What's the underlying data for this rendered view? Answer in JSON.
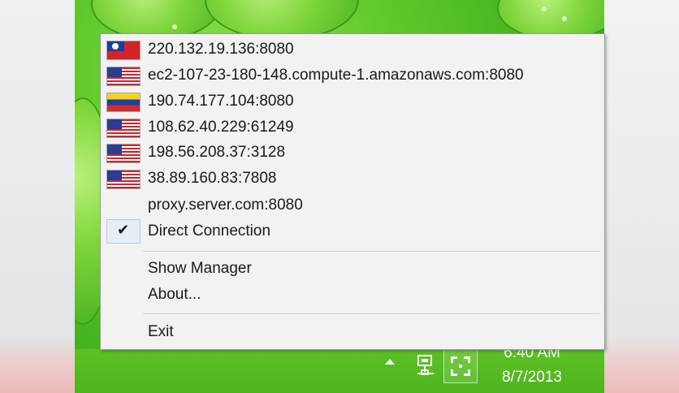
{
  "menu": {
    "proxies": [
      {
        "label": "220.132.19.136:8080",
        "flag": "taiwan-flag"
      },
      {
        "label": "ec2-107-23-180-148.compute-1.amazonaws.com:8080",
        "flag": "usa-flag"
      },
      {
        "label": "190.74.177.104:8080",
        "flag": "venezuela-flag"
      },
      {
        "label": "108.62.40.229:61249",
        "flag": "usa-flag"
      },
      {
        "label": "198.56.208.37:3128",
        "flag": "usa-flag"
      },
      {
        "label": "38.89.160.83:7808",
        "flag": "usa-flag"
      },
      {
        "label": "proxy.server.com:8080",
        "flag": ""
      }
    ],
    "direct_connection": {
      "label": "Direct Connection",
      "checked": true
    },
    "show_manager": "Show Manager",
    "about": "About...",
    "exit": "Exit"
  },
  "tray": {
    "time": "6:40 AM",
    "date": "8/7/2013",
    "icons": [
      "show-hidden-icons-arrow",
      "network-icon",
      "proxy-switcher-icon"
    ]
  },
  "colors": {
    "menu_background": "#f2f2f2",
    "wallpaper_green": "#4fb41d",
    "check_highlight": "#e6edf5"
  }
}
